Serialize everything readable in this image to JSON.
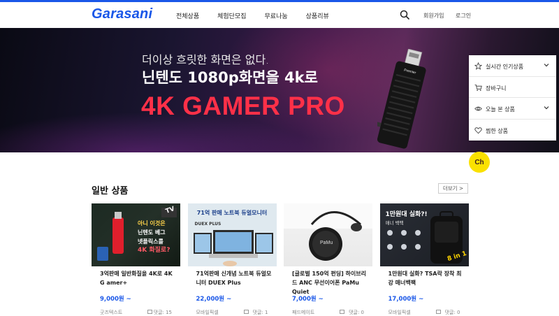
{
  "header": {
    "logo": "Garasani",
    "nav": [
      "전체상품",
      "체험단모집",
      "무료나눔",
      "상품리뷰"
    ],
    "signup": "회원가입",
    "login": "로그인"
  },
  "hero": {
    "subtitle": "더이상 흐릿한 화면은 없다.",
    "title": "닌텐도 1080p화면을 4k로",
    "headline": "4K GAMER PRO",
    "device_label": "Premier"
  },
  "quick_menu": [
    {
      "label": "실시간 인기상품",
      "icon": "star-icon",
      "chevron": true
    },
    {
      "label": "장바구니",
      "icon": "cart-icon",
      "chevron": false
    },
    {
      "label": "오늘 본 상품",
      "icon": "eye-icon",
      "chevron": true
    },
    {
      "label": "찜한 상품",
      "icon": "heart-icon",
      "chevron": false
    }
  ],
  "chat": {
    "label": "Ch"
  },
  "section": {
    "title": "일반 상품",
    "more": "더보기 >"
  },
  "products": [
    {
      "name": "3억판매 일반화질을 4K로 4K G amer+",
      "price": "9,000원 ~",
      "seller": "굿즈텍스트",
      "comments": "댓글: 15",
      "thumb_text": [
        "아니 이것은",
        "닌텐도 베그",
        "넷플릭스를",
        "4K 화질로?"
      ],
      "thumb_badge": "TV"
    },
    {
      "name": "71억판매 신개념 노트북 듀얼모 니터 DUEX Plus",
      "price": "22,000원 ~",
      "seller": "모바일픽셀",
      "comments": "댓글: 1",
      "thumb_text": [
        "71억 판매 노트북 듀얼모니터",
        "DUEX PLUS"
      ]
    },
    {
      "name": "[글로벌 150억 펀딩] 하이브리드 ANC 무선이어폰 PaMu Quiet",
      "price": "7,000원 ~",
      "seller": "패드메이트",
      "comments": "댓글: 0",
      "thumb_text": [
        "PaMu"
      ]
    },
    {
      "name": "1만원대 실화? TSA락 장착 최강 매너백팩",
      "price": "17,000원 ~",
      "seller": "모바일픽셀",
      "comments": "댓글: 0",
      "thumb_text": [
        "1만원대 실화?!",
        "매너 백팩",
        "8 in 1"
      ]
    }
  ],
  "colors": {
    "brand": "#1a57e8",
    "hero_headline": "#ff3048",
    "chat_bg": "#fae100"
  }
}
